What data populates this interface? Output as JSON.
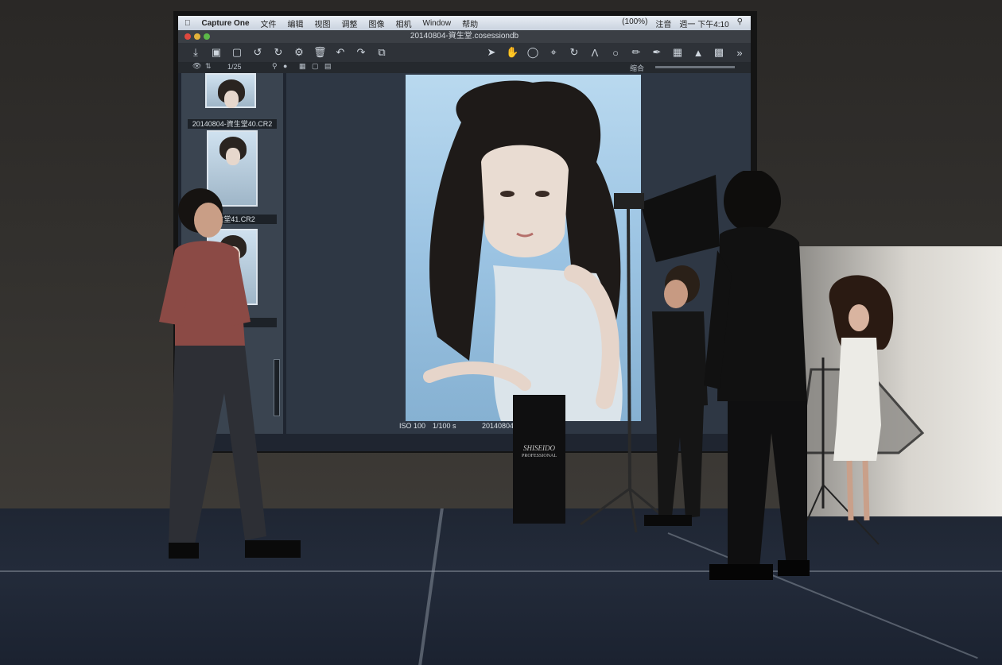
{
  "app_menubar": {
    "apple_icon": "apple-icon",
    "app_name": "Capture One",
    "menus": [
      "文件",
      "编辑",
      "视图",
      "调整",
      "图像",
      "相机",
      "Window",
      "帮助"
    ],
    "battery": "(100%)",
    "input_method": "注音",
    "clock": "週一 下午4:10"
  },
  "window": {
    "title": "20140804-資生堂.cosessiondb"
  },
  "browser": {
    "counter": "1/25",
    "items": [
      {
        "caption": "20140804-資生堂40.CR2"
      },
      {
        "caption": "資生堂41.CR2"
      },
      {
        "caption": "CR2"
      }
    ]
  },
  "subbar": {
    "label_right": "缩合"
  },
  "viewer_status": {
    "iso": "ISO 100",
    "shutter": "1/100 s",
    "filename": "20140804"
  },
  "podium": {
    "logo": "SHISEIDO",
    "logo_sub": "PROFESSIONAL"
  },
  "colors": {
    "screen_bg": "#1f2530",
    "photo_sky": "#9cc4e3",
    "menubar": "#dfe6ef"
  }
}
